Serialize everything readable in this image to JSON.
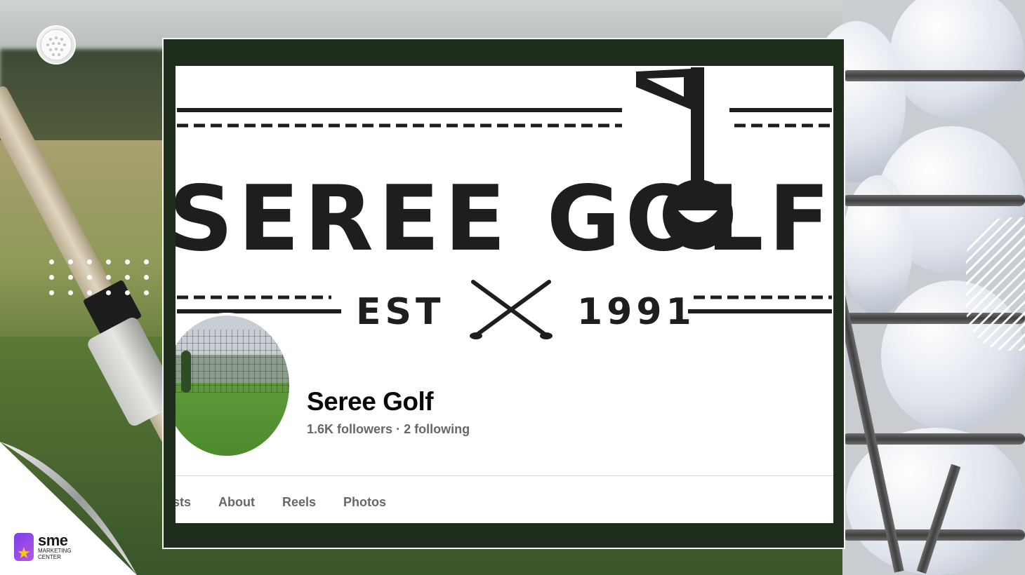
{
  "profile": {
    "name": "Seree Golf",
    "followers": "1.6K followers",
    "separator": "·",
    "following": "2 following"
  },
  "cover": {
    "title": "SEREE GOLF",
    "est_label": "EST",
    "year": "1991"
  },
  "tabs": [
    {
      "label": "sts"
    },
    {
      "label": "About"
    },
    {
      "label": "Reels"
    },
    {
      "label": "Photos"
    }
  ],
  "branding": {
    "brand_big": "sme",
    "brand_small_1": "MARKETING",
    "brand_small_2": "CENTER"
  },
  "colors": {
    "frame": "#1f2d1c",
    "logo_ink": "#1e1e1e",
    "accent_purple": "#7b3fe4",
    "accent_star": "#f7c71a"
  }
}
